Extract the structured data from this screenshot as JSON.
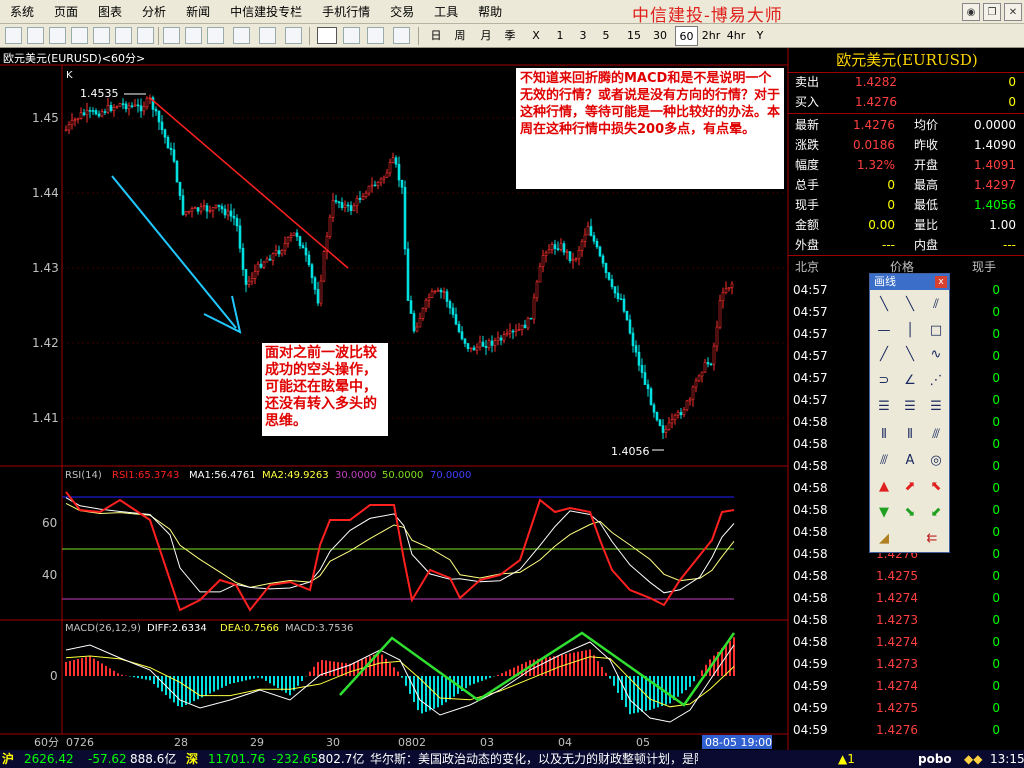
{
  "menu": [
    "系统",
    "页面",
    "图表",
    "分析",
    "新闻",
    "中信建投专栏",
    "手机行情",
    "交易",
    "工具",
    "帮助"
  ],
  "brand": "中信建投-博易大师",
  "periods": [
    "日",
    "周",
    "月",
    "季",
    "X",
    "1",
    "3",
    "5",
    "15",
    "30",
    "60",
    "2hr",
    "4hr",
    "Y"
  ],
  "active_period": "60",
  "chart": {
    "title": "欧元美元(EURUSD)<60分>",
    "k_label": "K",
    "high_label": "1.4535",
    "low_label": "1.4056",
    "price_ticks": [
      "1.45",
      "1.44",
      "1.43",
      "1.42",
      "1.41"
    ],
    "rsi_legend": {
      "name": "RSI(14)",
      "rsi1": "RSI1:65.3743",
      "ma1": "MA1:56.4761",
      "ma2": "MA2:49.9263",
      "l30": "30.0000",
      "l50": "50.0000",
      "l70": "70.0000"
    },
    "rsi_ticks": [
      "60",
      "40"
    ],
    "macd_legend": {
      "name": "MACD(26,12,9)",
      "diff": "DIFF:2.6334",
      "dea": "DEA:0.7566",
      "macd": "MACD:3.7536"
    },
    "macd_ticks": [
      "0"
    ],
    "x_labels": [
      "0726",
      "28",
      "29",
      "30",
      "0802",
      "03",
      "04",
      "05"
    ],
    "x_period": "60分",
    "x_cursor": "08-05 19:00"
  },
  "notes": {
    "top": "不知道来回折腾的MACD和是不是说明一个无效的行情？或者说是没有方向的行情？对于这种行情，等待可能是一种比较好的办法。本周在这种行情中损失200多点，有点晕。",
    "bottom": "面对之前一波比较成功的空头操作，可能还在眩晕中，还没有转入多头的思维。"
  },
  "quote": {
    "title": "欧元美元(EURUSD)",
    "sell_label": "卖出",
    "sell": "1.4282",
    "sell_vol": "0",
    "buy_label": "买入",
    "buy": "1.4276",
    "buy_vol": "0",
    "rows": [
      {
        "l1": "最新",
        "v1": "1.4276",
        "l2": "均价",
        "v2": "0.0000"
      },
      {
        "l1": "涨跌",
        "v1": "0.0186",
        "l2": "昨收",
        "v2": "1.4090"
      },
      {
        "l1": "幅度",
        "v1": "1.32%",
        "l2": "开盘",
        "v2": "1.4091"
      },
      {
        "l1": "总手",
        "v1": "0",
        "l2": "最高",
        "v2": "1.4297"
      },
      {
        "l1": "现手",
        "v1": "0",
        "l2": "最低",
        "v2": "1.4056"
      },
      {
        "l1": "金额",
        "v1": "0.00",
        "l2": "量比",
        "v2": "1.00"
      },
      {
        "l1": "外盘",
        "v1": "---",
        "l2": "内盘",
        "v2": "---"
      }
    ],
    "tick_header": {
      "time": "北京",
      "price": "价格",
      "vol": "现手"
    },
    "ticks": [
      {
        "t": "04:57",
        "p": "",
        "v": "0"
      },
      {
        "t": "04:57",
        "p": "",
        "v": "0"
      },
      {
        "t": "04:57",
        "p": "",
        "v": "0"
      },
      {
        "t": "04:57",
        "p": "",
        "v": "0"
      },
      {
        "t": "04:57",
        "p": "",
        "v": "0"
      },
      {
        "t": "04:57",
        "p": "",
        "v": "0"
      },
      {
        "t": "04:58",
        "p": "",
        "v": "0"
      },
      {
        "t": "04:58",
        "p": "",
        "v": "0"
      },
      {
        "t": "04:58",
        "p": "",
        "v": "0"
      },
      {
        "t": "04:58",
        "p": "",
        "v": "0"
      },
      {
        "t": "04:58",
        "p": "",
        "v": "0"
      },
      {
        "t": "04:58",
        "p": "",
        "v": "0"
      },
      {
        "t": "04:58",
        "p": "1.4276",
        "v": "0"
      },
      {
        "t": "04:58",
        "p": "1.4275",
        "v": "0"
      },
      {
        "t": "04:58",
        "p": "1.4274",
        "v": "0"
      },
      {
        "t": "04:58",
        "p": "1.4273",
        "v": "0"
      },
      {
        "t": "04:58",
        "p": "1.4274",
        "v": "0"
      },
      {
        "t": "04:59",
        "p": "1.4273",
        "v": "0"
      },
      {
        "t": "04:59",
        "p": "1.4274",
        "v": "0"
      },
      {
        "t": "04:59",
        "p": "1.4275",
        "v": "0"
      },
      {
        "t": "04:59",
        "p": "1.4276",
        "v": "0"
      }
    ]
  },
  "palette": {
    "title": "画线",
    "close": "x"
  },
  "status": {
    "sh_label": "沪",
    "sh_index": "2626.42",
    "sh_change": "-57.62",
    "sh_amount": "888.6亿",
    "sz_label": "深",
    "sz_index": "11701.76",
    "sz_change": "-232.65",
    "sz_amount": "802.7亿",
    "news": "华尔斯：美国政治动态的变化，以及无力的财政整顿计划，是降级的主因",
    "alert": "▲1",
    "logo": "pobo",
    "time": "13:15"
  }
}
